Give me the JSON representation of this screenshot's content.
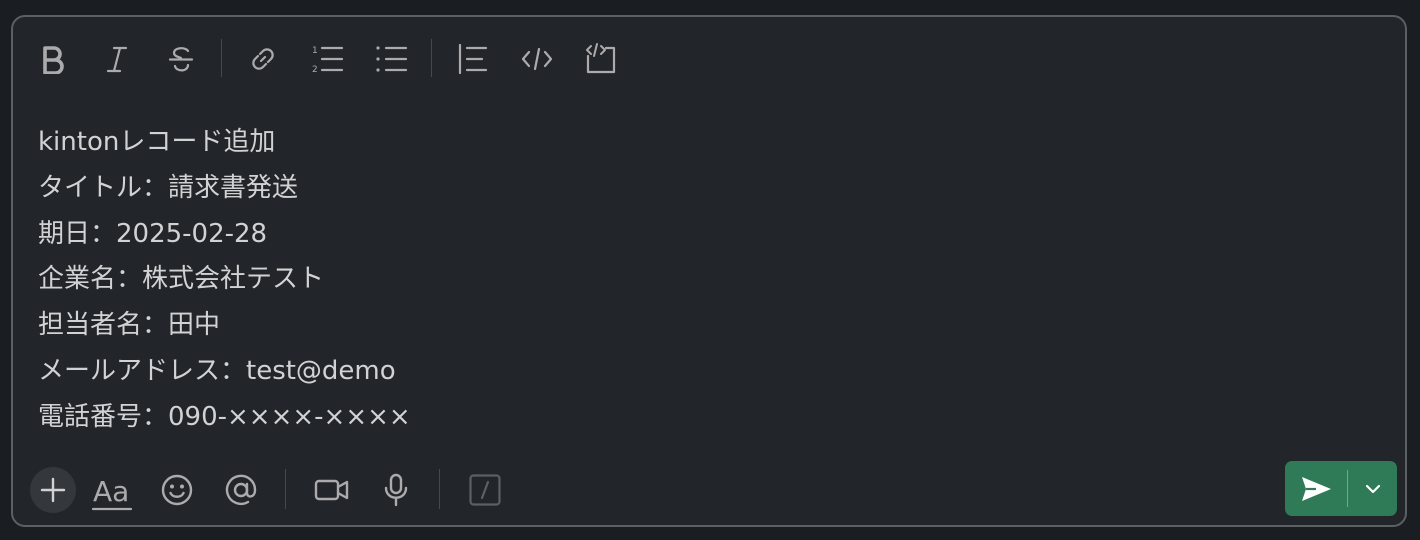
{
  "toolbar": {
    "buttons": [
      {
        "name": "bold",
        "icon": "bold-icon"
      },
      {
        "name": "italic",
        "icon": "italic-icon"
      },
      {
        "name": "strikethrough",
        "icon": "strikethrough-icon"
      },
      {
        "name": "link",
        "icon": "link-icon"
      },
      {
        "name": "ordered-list",
        "icon": "ordered-list-icon"
      },
      {
        "name": "bulleted-list",
        "icon": "bulleted-list-icon"
      },
      {
        "name": "blockquote",
        "icon": "blockquote-icon"
      },
      {
        "name": "code",
        "icon": "code-icon"
      },
      {
        "name": "code-block",
        "icon": "code-block-icon"
      }
    ]
  },
  "message": {
    "lines": [
      "kintonレコード追加",
      "タイトル：請求書発送",
      "期日：2025-02-28",
      "企業名：株式会社テスト",
      "担当者名：田中",
      "メールアドレス：test@demo",
      "電話番号：090-××××-××××"
    ]
  },
  "bottom_bar": {
    "buttons": [
      {
        "name": "attach",
        "icon": "plus-icon"
      },
      {
        "name": "formatting",
        "icon": "text-format-icon",
        "label": "Aa"
      },
      {
        "name": "emoji",
        "icon": "emoji-icon"
      },
      {
        "name": "mention",
        "icon": "at-sign-icon"
      },
      {
        "name": "video-clip",
        "icon": "video-camera-icon"
      },
      {
        "name": "audio-clip",
        "icon": "microphone-icon"
      },
      {
        "name": "shortcuts",
        "icon": "slash-command-icon"
      }
    ],
    "send": {
      "icon": "send-icon",
      "options_icon": "chevron-down-icon",
      "color": "#2f7a57"
    }
  },
  "colors": {
    "background": "#1a1d21",
    "composer": "#222529",
    "border": "#5c5f63",
    "text": "#d1d2d3",
    "icon": "#ababad"
  }
}
